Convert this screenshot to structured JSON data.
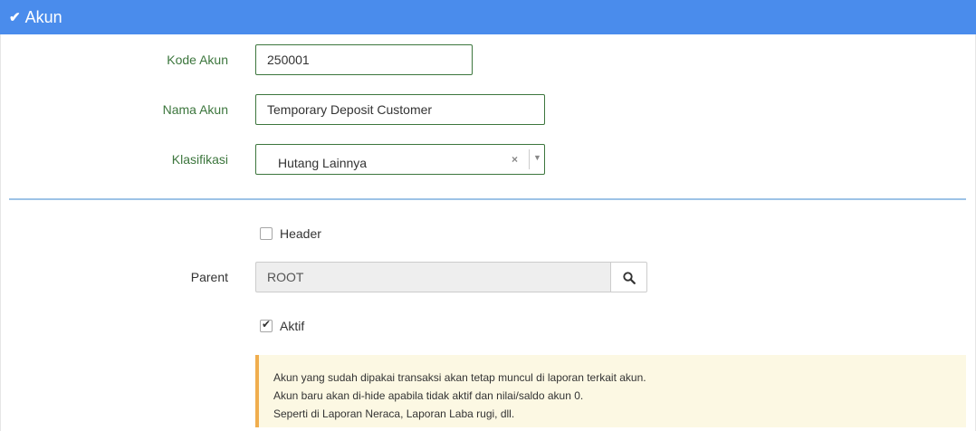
{
  "header": {
    "title": "Akun"
  },
  "form": {
    "kode": {
      "label": "Kode Akun",
      "value": "250001"
    },
    "nama": {
      "label": "Nama Akun",
      "value": "Temporary Deposit Customer"
    },
    "klasifikasi": {
      "label": "Klasifikasi",
      "value": "Hutang Lainnya",
      "clear_glyph": "×",
      "caret_glyph": "▼"
    }
  },
  "header_checkbox": {
    "label": "Header",
    "checked": false
  },
  "parent": {
    "label": "Parent",
    "value": "ROOT"
  },
  "aktif_checkbox": {
    "label": "Aktif",
    "checked": true
  },
  "note": {
    "lines": [
      "Akun yang sudah dipakai transaksi akan tetap muncul di laporan terkait akun.",
      "Akun baru akan di-hide apabila tidak aktif dan nilai/saldo akun 0.",
      "Seperti di Laporan Neraca, Laporan Laba rugi, dll."
    ]
  },
  "colors": {
    "header_bg": "#4a8cec",
    "label_green": "#3c763d",
    "divider": "#9dc3e6",
    "note_bg": "#fcf8e3",
    "note_border": "#f0ad4e"
  }
}
